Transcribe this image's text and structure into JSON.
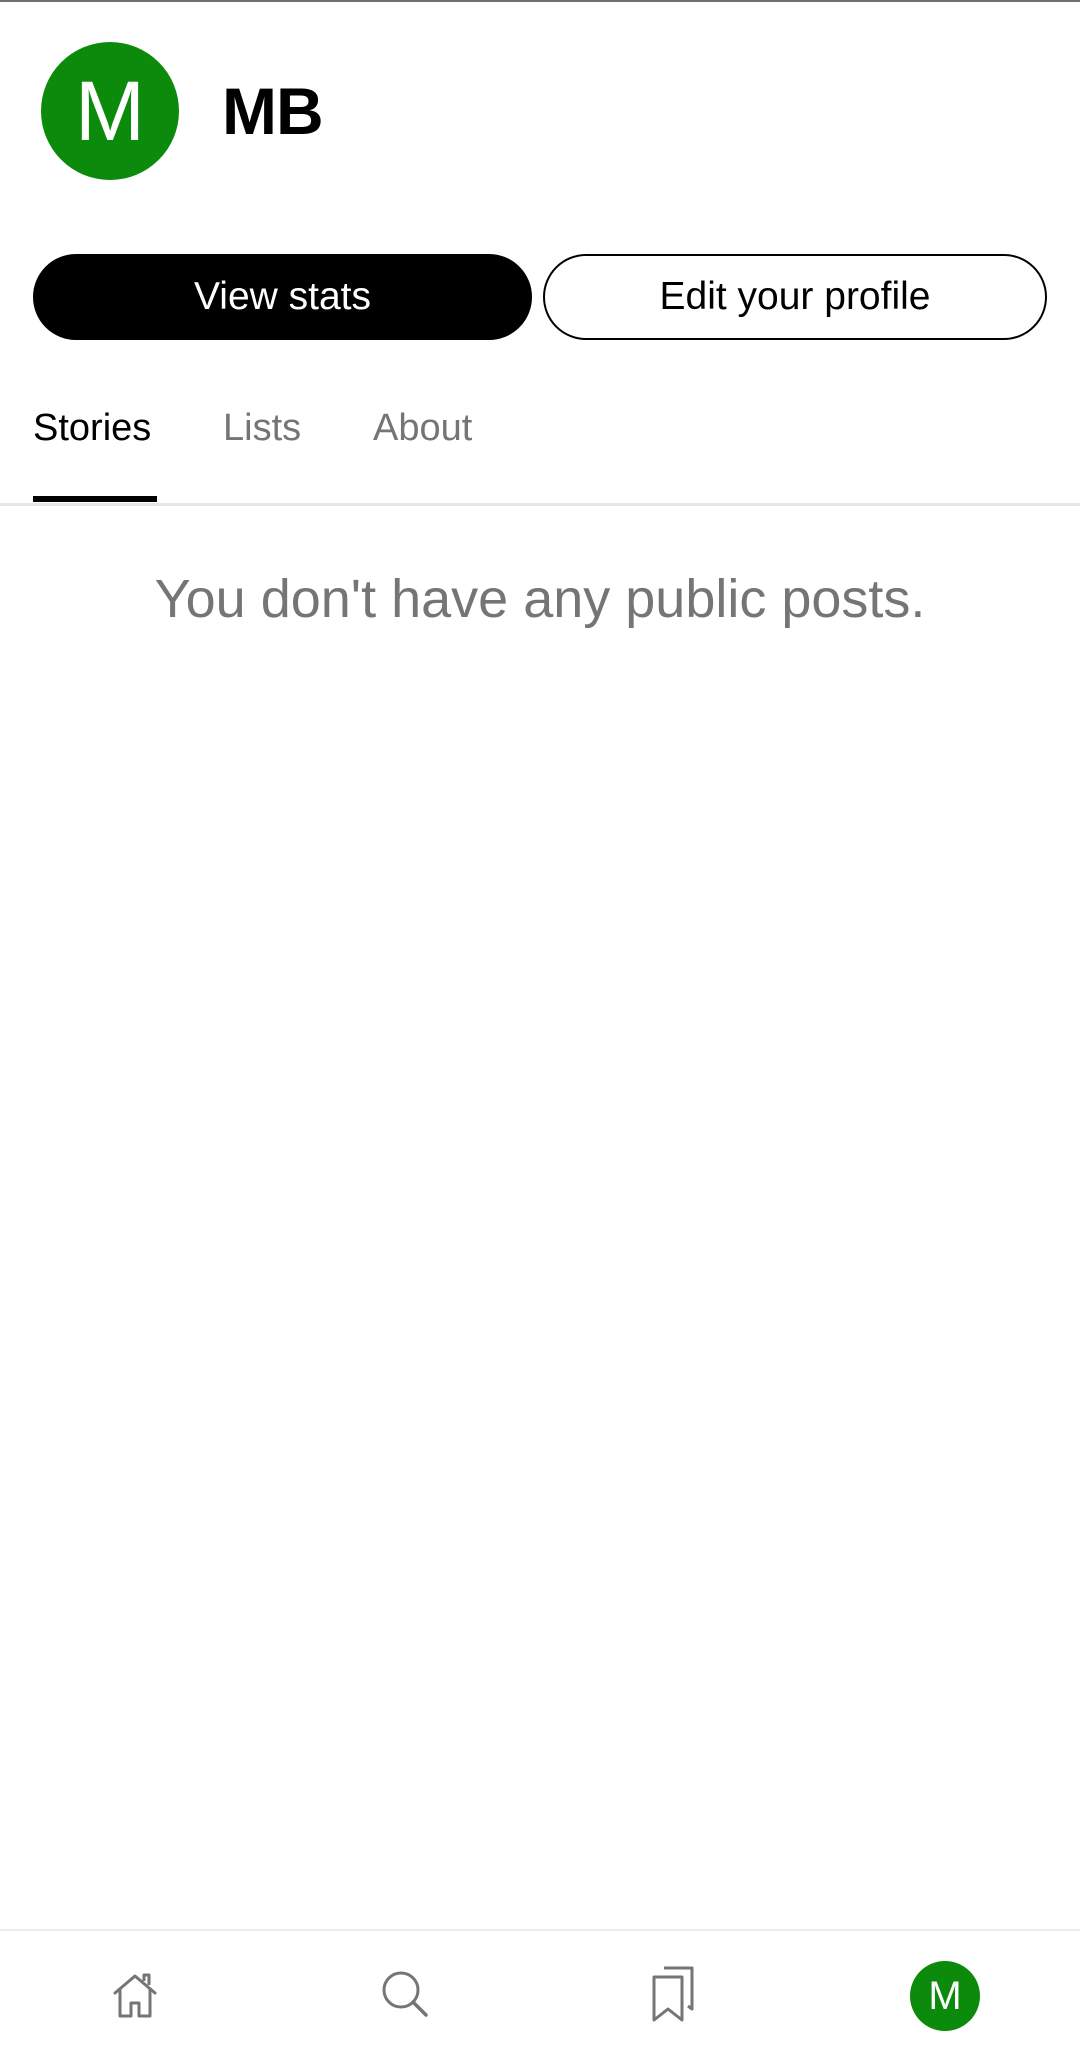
{
  "profile": {
    "avatar_letter": "M",
    "name": "MB",
    "avatar_color": "#0b8a0b"
  },
  "actions": {
    "view_stats_label": "View stats",
    "edit_profile_label": "Edit your profile"
  },
  "tabs": [
    {
      "label": "Stories",
      "active": true
    },
    {
      "label": "Lists",
      "active": false
    },
    {
      "label": "About",
      "active": false
    }
  ],
  "content": {
    "empty_message": "You don't have any public posts."
  },
  "bottom_nav": {
    "items": [
      {
        "icon": "home-icon"
      },
      {
        "icon": "search-icon"
      },
      {
        "icon": "bookmarks-icon"
      },
      {
        "icon": "profile-avatar",
        "letter": "M",
        "active": true
      }
    ]
  },
  "colors": {
    "accent": "#0b8a0b",
    "inactive_text": "#757575",
    "primary": "#000000"
  }
}
